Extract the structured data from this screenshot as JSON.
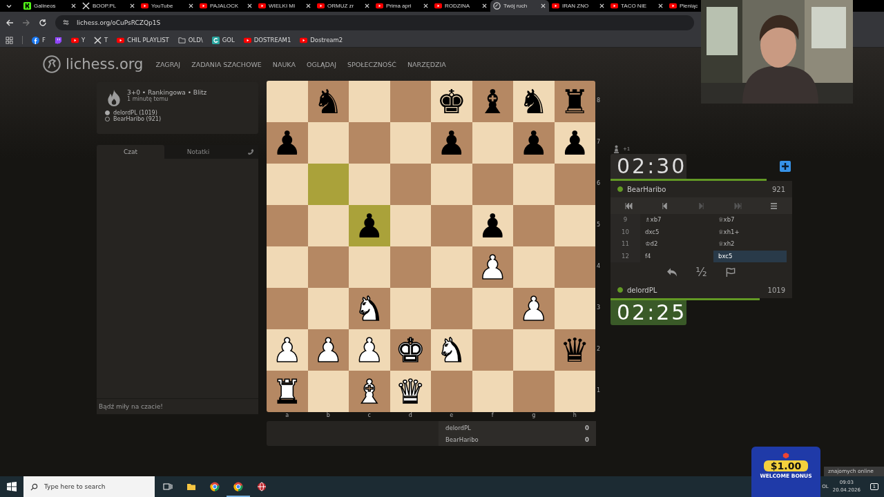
{
  "browser": {
    "tabs": [
      {
        "label": "Galineos",
        "kind": "kick",
        "selected": false
      },
      {
        "label": "BOOP.PL",
        "kind": "x",
        "selected": false
      },
      {
        "label": "YouTube",
        "kind": "youtube",
        "selected": false
      },
      {
        "label": "PAJALOCK",
        "kind": "youtube",
        "selected": false
      },
      {
        "label": "WIELKI MI",
        "kind": "youtube",
        "selected": false
      },
      {
        "label": "ORMUZ zr",
        "kind": "youtube",
        "selected": false
      },
      {
        "label": "Prima apri",
        "kind": "youtube",
        "selected": false
      },
      {
        "label": "RODZINA",
        "kind": "youtube",
        "selected": false
      },
      {
        "label": "Twój ruch",
        "kind": "lichess",
        "selected": true
      },
      {
        "label": "IRAN ZNO",
        "kind": "youtube",
        "selected": false
      },
      {
        "label": "TACO NIE",
        "kind": "youtube",
        "selected": false
      },
      {
        "label": "Pieniąc",
        "kind": "youtube",
        "selected": false
      }
    ],
    "address": "lichess.org/oCuPsRCZQp1S",
    "bookmarks": [
      {
        "kind": "facebook",
        "label": "F"
      },
      {
        "kind": "twitch"
      },
      {
        "kind": "youtube",
        "label": "Y"
      },
      {
        "kind": "x",
        "label": "T"
      },
      {
        "kind": "youtube",
        "label": "CHIL PLAYLIST"
      },
      {
        "kind": "folder",
        "label": "OLD\\"
      },
      {
        "kind": "gol",
        "label": "GOL"
      },
      {
        "kind": "youtube",
        "label": "DOSTREAM1"
      },
      {
        "kind": "youtube",
        "label": "Dostream2"
      }
    ]
  },
  "site": {
    "logo": "lichess.org",
    "nav": [
      "ZAGRAJ",
      "ZADANIA SZACHOWE",
      "NAUKA",
      "OGLĄDAJ",
      "SPOŁECZNOŚĆ",
      "NARZĘDZIA"
    ]
  },
  "game_info": {
    "title": "3+0 • Rankingowa • Blitz",
    "time": "1 minutę temu",
    "players": [
      {
        "name": "delordPL (1019)",
        "kind": "white"
      },
      {
        "name": "BearHaribo (921)",
        "kind": "black"
      }
    ]
  },
  "chat": {
    "tabs": [
      {
        "label": "Czat",
        "selected": true
      },
      {
        "label": "Notatki",
        "selected": false
      }
    ],
    "placeholder": "Bądź miły na czacie!"
  },
  "board": {
    "ranks": [
      {
        "label": "8",
        "squares": [
          {
            "last_move": false
          },
          {
            "piece": "♞",
            "kind": "black",
            "last_move": false
          },
          {
            "last_move": false
          },
          {
            "last_move": false
          },
          {
            "piece": "♚",
            "kind": "black",
            "last_move": false
          },
          {
            "piece": "♝",
            "kind": "black",
            "last_move": false
          },
          {
            "piece": "♞",
            "kind": "black",
            "last_move": false
          },
          {
            "piece": "♜",
            "kind": "black",
            "last_move": false
          }
        ]
      },
      {
        "label": "7",
        "squares": [
          {
            "piece": "♟",
            "kind": "black",
            "last_move": false
          },
          {
            "last_move": false
          },
          {
            "last_move": false
          },
          {
            "last_move": false
          },
          {
            "piece": "♟",
            "kind": "black",
            "last_move": false
          },
          {
            "last_move": false
          },
          {
            "piece": "♟",
            "kind": "black",
            "last_move": false
          },
          {
            "piece": "♟",
            "kind": "black",
            "last_move": false
          }
        ]
      },
      {
        "label": "6",
        "squares": [
          {
            "last_move": false
          },
          {
            "last_move": true
          },
          {
            "last_move": false
          },
          {
            "last_move": false
          },
          {
            "last_move": false
          },
          {
            "last_move": false
          },
          {
            "last_move": false
          },
          {
            "last_move": false
          }
        ]
      },
      {
        "label": "5",
        "squares": [
          {
            "last_move": false
          },
          {
            "last_move": false
          },
          {
            "piece": "♟",
            "kind": "black",
            "last_move": true
          },
          {
            "last_move": false
          },
          {
            "last_move": false
          },
          {
            "piece": "♟",
            "kind": "black",
            "last_move": false
          },
          {
            "last_move": false
          },
          {
            "last_move": false
          }
        ]
      },
      {
        "label": "4",
        "squares": [
          {
            "last_move": false
          },
          {
            "last_move": false
          },
          {
            "last_move": false
          },
          {
            "last_move": false
          },
          {
            "last_move": false
          },
          {
            "piece": "♟",
            "kind": "white",
            "last_move": false
          },
          {
            "last_move": false
          },
          {
            "last_move": false
          }
        ]
      },
      {
        "label": "3",
        "squares": [
          {
            "last_move": false
          },
          {
            "last_move": false
          },
          {
            "piece": "♞",
            "kind": "white",
            "last_move": false
          },
          {
            "last_move": false
          },
          {
            "last_move": false
          },
          {
            "last_move": false
          },
          {
            "piece": "♟",
            "kind": "white",
            "last_move": false
          },
          {
            "last_move": false
          }
        ]
      },
      {
        "label": "2",
        "squares": [
          {
            "piece": "♟",
            "kind": "white",
            "last_move": false
          },
          {
            "piece": "♟",
            "kind": "white",
            "last_move": false
          },
          {
            "piece": "♟",
            "kind": "white",
            "last_move": false
          },
          {
            "piece": "♚",
            "kind": "white",
            "last_move": false
          },
          {
            "piece": "♞",
            "kind": "white",
            "last_move": false
          },
          {
            "last_move": false
          },
          {
            "last_move": false
          },
          {
            "piece": "♛",
            "kind": "black",
            "last_move": false
          }
        ]
      },
      {
        "label": "1",
        "squares": [
          {
            "piece": "♜",
            "kind": "white",
            "last_move": false
          },
          {
            "last_move": false
          },
          {
            "piece": "♝",
            "kind": "white",
            "last_move": false
          },
          {
            "piece": "♛",
            "kind": "white",
            "last_move": false
          },
          {
            "last_move": false
          },
          {
            "last_move": false
          },
          {
            "last_move": false
          },
          {
            "last_move": false
          }
        ]
      }
    ],
    "files": [
      "a",
      "b",
      "c",
      "d",
      "e",
      "f",
      "g",
      "h"
    ]
  },
  "score": [
    {
      "name": "delordPL",
      "points": "0"
    },
    {
      "name": "BearHaribo",
      "points": "0"
    }
  ],
  "opponent": {
    "material": "+1",
    "clock": "02:30",
    "running": false,
    "level": 0.86,
    "name": "BearHaribo",
    "rating": "921",
    "online": true
  },
  "moves": [
    {
      "number": "9",
      "white": {
        "san": "♗xb7",
        "selected": false
      },
      "black": {
        "san": "♕xb7",
        "selected": false
      }
    },
    {
      "number": "10",
      "white": {
        "san": "dxc5",
        "selected": false
      },
      "black": {
        "san": "♕xh1+",
        "selected": false
      }
    },
    {
      "number": "11",
      "white": {
        "san": "♔d2",
        "selected": false
      },
      "black": {
        "san": "♕xh2",
        "selected": false
      }
    },
    {
      "number": "12",
      "white": {
        "san": "f4",
        "selected": false
      },
      "black": {
        "san": "bxc5",
        "selected": true
      }
    }
  ],
  "actions": {
    "draw": "½"
  },
  "player": {
    "name": "delordPL",
    "rating": "1019",
    "online": true,
    "level": 0.82,
    "clock": "02:25",
    "running": true
  },
  "ad": {
    "amount": "$1.00",
    "caption": "WELCOME BONUS"
  },
  "taskbar": {
    "search_placeholder": "Type here to search",
    "friends": "znajomych online",
    "language": "OL",
    "time": "09:03",
    "date": "20.04.2026",
    "notifications": "1"
  }
}
